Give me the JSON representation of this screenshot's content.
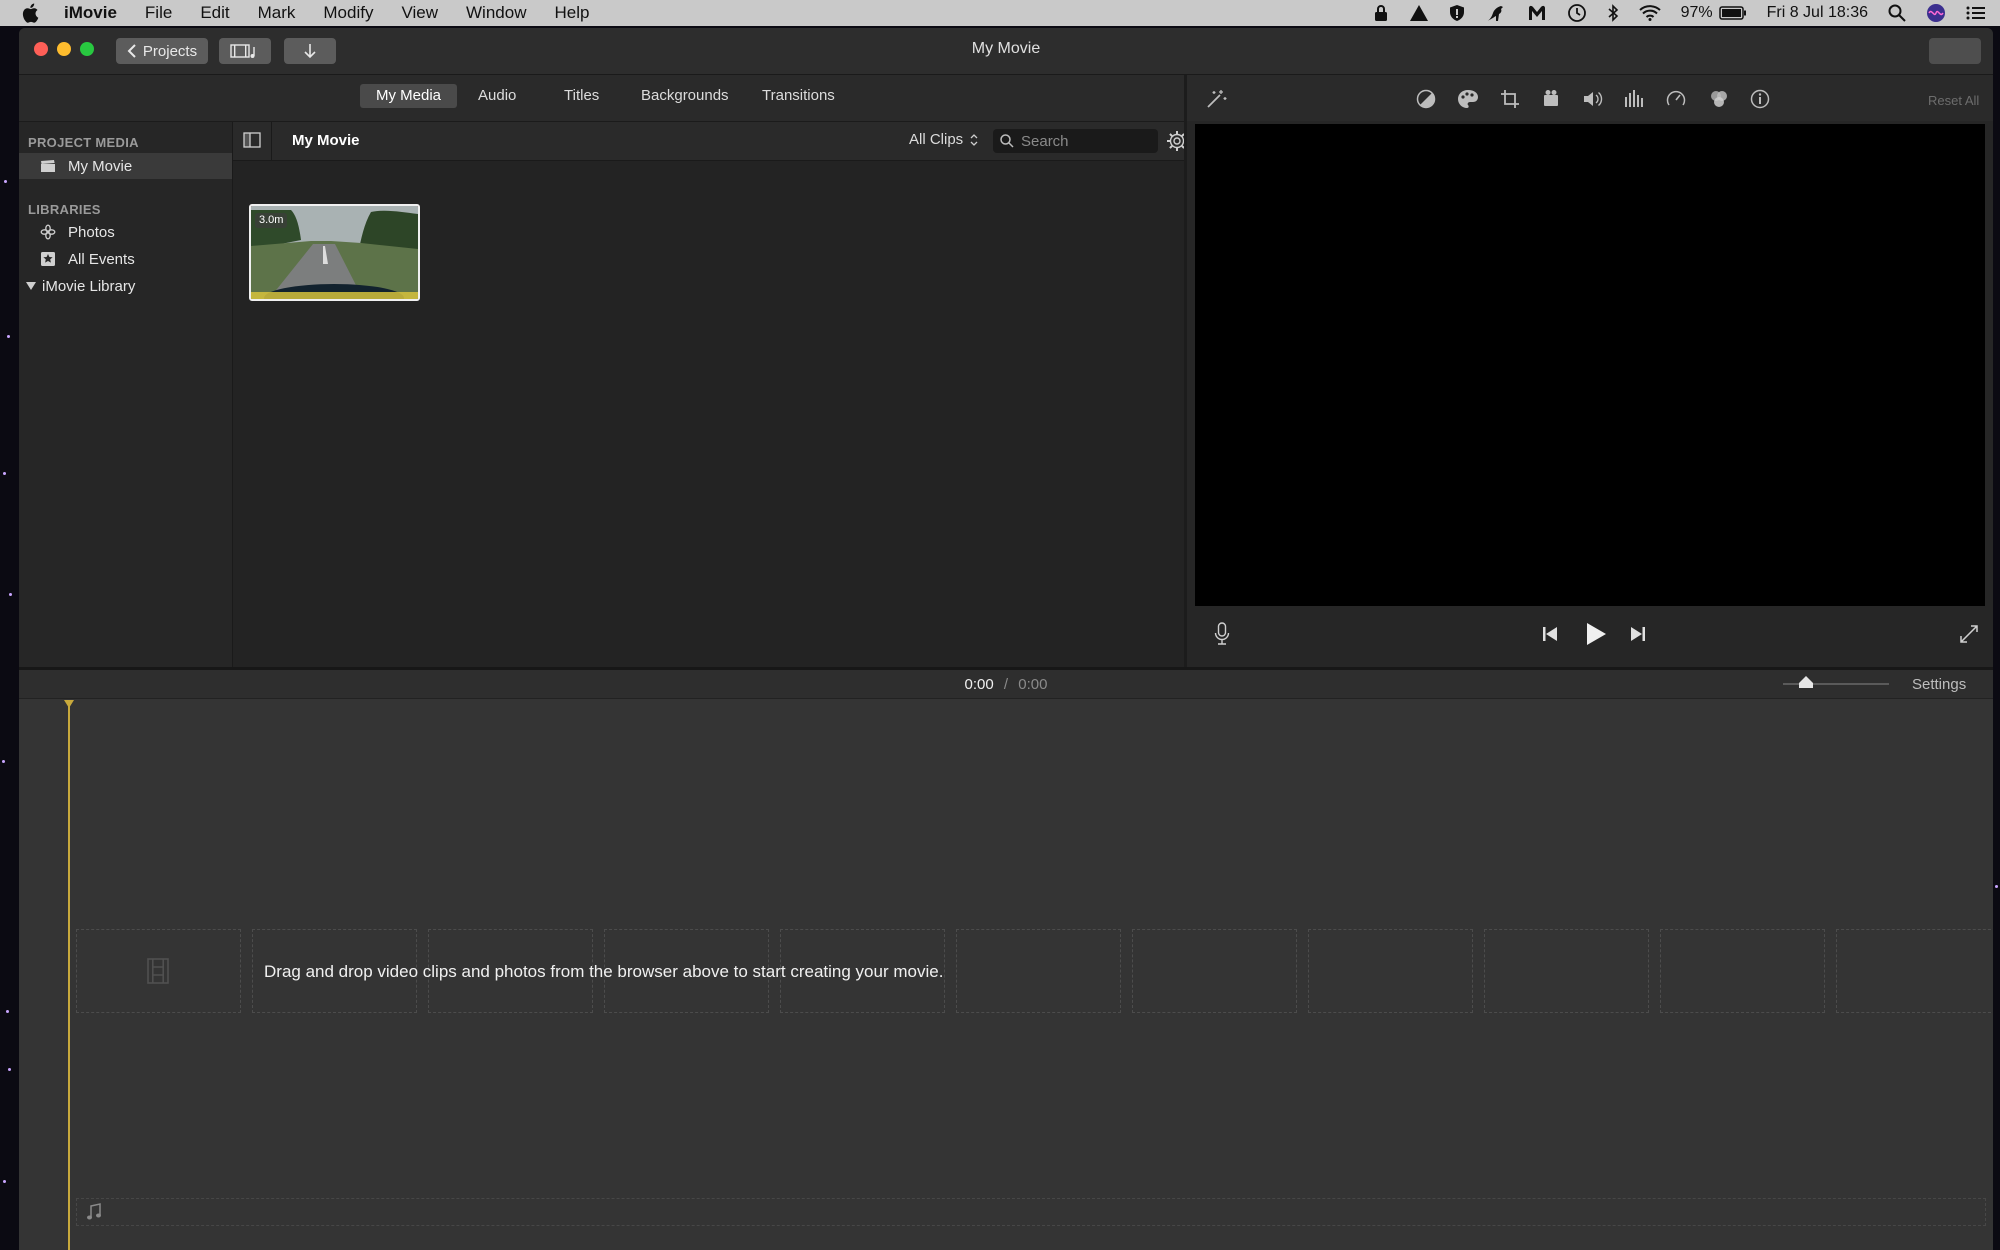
{
  "menubar": {
    "app_name": "iMovie",
    "menus": [
      "File",
      "Edit",
      "Mark",
      "Modify",
      "View",
      "Window",
      "Help"
    ],
    "battery": "97%",
    "clock": "Fri 8 Jul  18:36"
  },
  "window": {
    "title": "My Movie",
    "projects_button": "Projects"
  },
  "media_tabs": [
    {
      "label": "My Media",
      "active": true
    },
    {
      "label": "Audio",
      "active": false
    },
    {
      "label": "Titles",
      "active": false
    },
    {
      "label": "Backgrounds",
      "active": false
    },
    {
      "label": "Transitions",
      "active": false
    }
  ],
  "sidebar": {
    "project_media_heading": "PROJECT MEDIA",
    "project_item": "My Movie",
    "libraries_heading": "LIBRARIES",
    "photos": "Photos",
    "all_events": "All Events",
    "library": "iMovie Library"
  },
  "browser": {
    "title": "My Movie",
    "filter": "All Clips",
    "search_placeholder": "Search",
    "clip_duration": "3.0m"
  },
  "inspector": {
    "reset_all": "Reset All"
  },
  "timeline": {
    "current_time": "0:00",
    "separator": "/",
    "total_time": "0:00",
    "settings": "Settings",
    "zoom_level": 0.22,
    "drop_hint": "Drag and drop video clips and photos from the browser above to start creating your movie."
  },
  "colors": {
    "accent_active_tab": "#4a4a4a",
    "playhead": "#c8a93c",
    "clip_selected_top": "#e0312b"
  }
}
